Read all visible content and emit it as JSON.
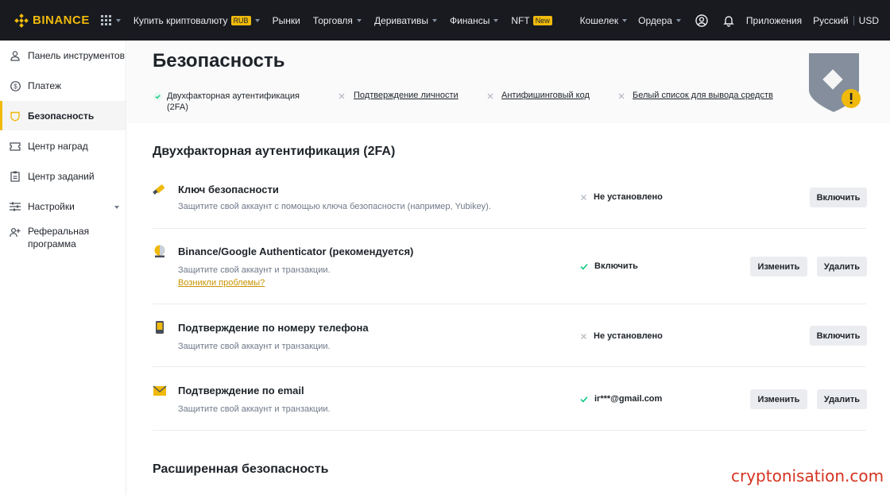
{
  "topbar": {
    "logo": "BINANCE",
    "nav": [
      {
        "label": "Купить криптовалюту",
        "tag": "RUB",
        "caret": true
      },
      {
        "label": "Рынки",
        "caret": false
      },
      {
        "label": "Торговля",
        "caret": true
      },
      {
        "label": "Деривативы",
        "caret": true
      },
      {
        "label": "Финансы",
        "caret": true
      },
      {
        "label": "NFT",
        "tag": "New",
        "caret": false
      }
    ],
    "right": {
      "wallet": "Кошелек",
      "orders": "Ордера",
      "apps": "Приложения",
      "language": "Русский",
      "currency": "USD"
    }
  },
  "sidebar": {
    "items": [
      {
        "label": "Панель инструментов",
        "icon": "user-icon"
      },
      {
        "label": "Платеж",
        "icon": "dollar-icon"
      },
      {
        "label": "Безопасность",
        "icon": "shield-icon",
        "active": true
      },
      {
        "label": "Центр наград",
        "icon": "ticket-icon"
      },
      {
        "label": "Центр заданий",
        "icon": "clipboard-icon"
      },
      {
        "label": "Настройки",
        "icon": "sliders-icon"
      },
      {
        "label": "Реферальная программа",
        "icon": "add-user-icon"
      }
    ]
  },
  "header": {
    "title": "Безопасность",
    "checklist": [
      {
        "label": "Двухфакторная аутентификация (2FA)",
        "done": true
      },
      {
        "label": "Подтверждение личности",
        "done": false
      },
      {
        "label": "Антифишинговый код",
        "done": false
      },
      {
        "label": "Белый список для вывода средств",
        "done": false
      }
    ]
  },
  "twofa": {
    "title": "Двухфакторная аутентификация (2FA)",
    "rows": [
      {
        "title": "Ключ безопасности",
        "desc": "Защитите свой аккаунт с помощью ключа безопасности (например, Yubikey).",
        "status": "Не установлено",
        "enabled": false,
        "buttons": [
          "Включить"
        ]
      },
      {
        "title": "Binance/Google Authenticator (рекомендуется)",
        "desc": "Защитите свой аккаунт и транзакции.",
        "link": "Возникли проблемы?",
        "status": "Включить",
        "enabled": true,
        "buttons": [
          "Изменить",
          "Удалить"
        ]
      },
      {
        "title": "Подтверждение по номеру телефона",
        "desc": "Защитите свой аккаунт и транзакции.",
        "status": "Не установлено",
        "enabled": false,
        "buttons": [
          "Включить"
        ]
      },
      {
        "title": "Подтверждение по email",
        "desc": "Защитите свой аккаунт и транзакции.",
        "status": "ir***@gmail.com",
        "enabled": true,
        "buttons": [
          "Изменить",
          "Удалить"
        ]
      }
    ]
  },
  "advanced": {
    "title": "Расширенная безопасность"
  },
  "watermark": "cryptonisation.com",
  "colors": {
    "brand": "#f0b90b",
    "topbar": "#181a20",
    "ok": "#0ecb81",
    "link": "#c99400"
  }
}
